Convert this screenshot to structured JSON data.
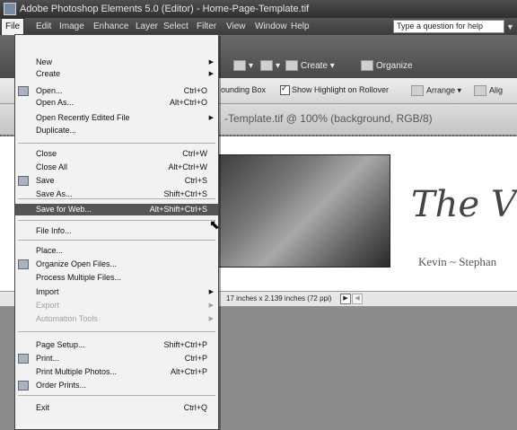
{
  "window": {
    "title": "Adobe Photoshop Elements 5.0 (Editor) - Home-Page-Template.tif"
  },
  "menubar": {
    "items": [
      "File",
      "Edit",
      "Image",
      "Enhance",
      "Layer",
      "Select",
      "Filter",
      "View",
      "Window",
      "Help"
    ],
    "help_placeholder": "Type a question for help"
  },
  "toolbar": {
    "create_label": "Create",
    "organize_label": "Organize"
  },
  "options": {
    "bounding_box": "ounding Box",
    "show_highlight": "Show Highlight on Rollover",
    "arrange": "Arrange",
    "align": "Alig"
  },
  "document": {
    "tab_title": "-Template.tif @ 100% (background, RGB/8)",
    "script_title": "The V",
    "names": "Kevin ~ Stephan",
    "size_info": "17 inches x 2.139 inches (72 ppi)"
  },
  "file_menu": {
    "items": [
      {
        "label": "New",
        "shortcut": "",
        "submenu": true
      },
      {
        "label": "Create",
        "shortcut": "",
        "submenu": true
      },
      {
        "label": "Open...",
        "shortcut": "Ctrl+O",
        "icon": "open-icon"
      },
      {
        "label": "Open As...",
        "shortcut": "Alt+Ctrl+O"
      },
      {
        "label": "Open Recently Edited File",
        "shortcut": "",
        "submenu": true
      },
      {
        "label": "Duplicate...",
        "shortcut": ""
      },
      {
        "label": "Close",
        "shortcut": "Ctrl+W"
      },
      {
        "label": "Close All",
        "shortcut": "Alt+Ctrl+W"
      },
      {
        "label": "Save",
        "shortcut": "Ctrl+S",
        "icon": "save-icon"
      },
      {
        "label": "Save As...",
        "shortcut": "Shift+Ctrl+S"
      },
      {
        "label": "Save for Web...",
        "shortcut": "Alt+Shift+Ctrl+S",
        "highlighted": true
      },
      {
        "label": "File Info...",
        "shortcut": ""
      },
      {
        "label": "Place...",
        "shortcut": ""
      },
      {
        "label": "Organize Open Files...",
        "shortcut": "",
        "icon": "organize-icon"
      },
      {
        "label": "Process Multiple Files...",
        "shortcut": ""
      },
      {
        "label": "Import",
        "shortcut": "",
        "submenu": true
      },
      {
        "label": "Export",
        "shortcut": "",
        "submenu": true,
        "disabled": true
      },
      {
        "label": "Automation Tools",
        "shortcut": "",
        "submenu": true,
        "disabled": true
      },
      {
        "label": "Page Setup...",
        "shortcut": "Shift+Ctrl+P"
      },
      {
        "label": "Print...",
        "shortcut": "Ctrl+P",
        "icon": "print-icon"
      },
      {
        "label": "Print Multiple Photos...",
        "shortcut": "Alt+Ctrl+P"
      },
      {
        "label": "Order Prints...",
        "shortcut": "",
        "icon": "order-prints-icon"
      },
      {
        "label": "Exit",
        "shortcut": "Ctrl+Q"
      }
    ]
  }
}
